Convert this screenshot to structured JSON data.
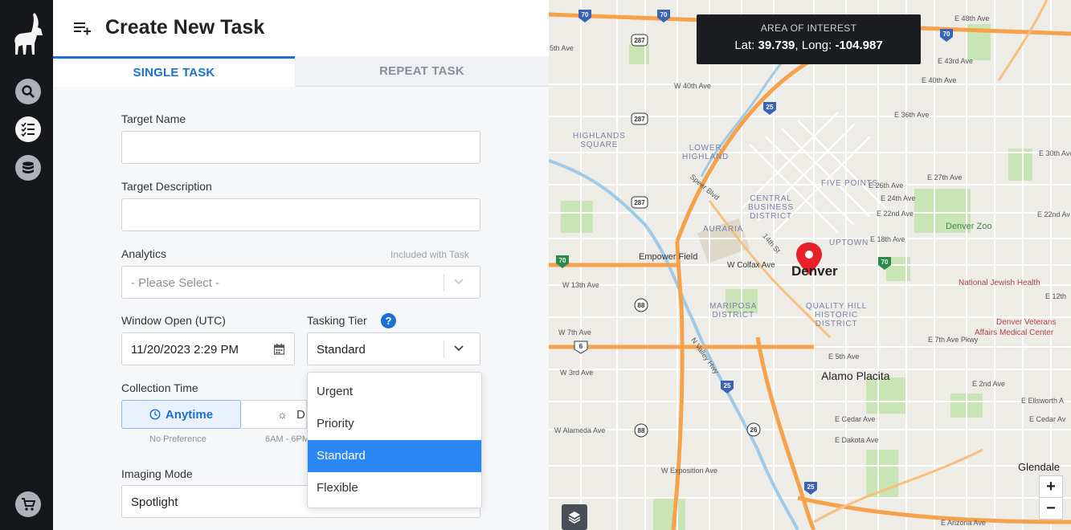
{
  "sidebar": {
    "items": [
      {
        "name": "search-icon"
      },
      {
        "name": "task-list-icon"
      },
      {
        "name": "database-icon"
      }
    ],
    "cart": "cart-icon"
  },
  "header": {
    "title": "Create New Task"
  },
  "tabs": {
    "single": "SINGLE TASK",
    "repeat": "REPEAT TASK"
  },
  "form": {
    "target_name": {
      "label": "Target Name",
      "value": ""
    },
    "target_description": {
      "label": "Target Description",
      "value": ""
    },
    "analytics": {
      "label": "Analytics",
      "hint": "Included with Task",
      "placeholder": "- Please Select -"
    },
    "window_open": {
      "label": "Window Open (UTC)",
      "value": "11/20/2023 2:29 PM"
    },
    "tasking_tier": {
      "label": "Tasking Tier",
      "value": "Standard",
      "options": [
        "Urgent",
        "Priority",
        "Standard",
        "Flexible"
      ],
      "selected": "Standard"
    },
    "collection_time": {
      "label": "Collection Time",
      "anytime": "Anytime",
      "anytime_sub": "No Preference",
      "day_partial": "D",
      "day_sub_partial": "6AM - 6PM"
    },
    "imaging_mode": {
      "label": "Imaging Mode",
      "value": "Spotlight"
    }
  },
  "map": {
    "aoi_title": "AREA OF INTEREST",
    "lat_label": "Lat:",
    "lat": "39.739",
    "long_label": "Long:",
    "long": "-104.987",
    "city": "Denver",
    "labels": {
      "alamo": "Alamo Placita",
      "glendale": "Glendale",
      "empower": "Empower Field",
      "w_colfax": "W Colfax Ave",
      "zoo": "Denver Zoo",
      "national_jewish": "National Jewish Health",
      "va": "Denver Veterans",
      "va2": "Affairs Medical Center",
      "e48": "E 48th Ave",
      "e43": "E 43rd Ave",
      "e40": "E 40th Ave",
      "e36": "E 36th Ave",
      "e30": "E 30th Ave",
      "e27": "E 27th Ave",
      "e26": "E 26th Ave",
      "e24": "E 24th Ave",
      "e22": "E 22nd Ave",
      "e22r": "E 22nd Av",
      "e18": "E 18th Ave",
      "e12": "E 12th",
      "e7": "E 7th Ave Pkwy",
      "e5": "E 5th Ave",
      "e2": "E 2nd Ave",
      "ee": "E Ellsworth A",
      "ecedar": "E Cedar Ave",
      "ecedar2": "E Cedar Av",
      "edak": "E Dakota Ave",
      "eariz": "E Arizona Ave",
      "w40": "W 40th Ave",
      "w13": "W 13th Ave",
      "w7": "W 7th Ave",
      "w3": "W 3rd Ave",
      "wal": "W Alameda Ave",
      "wexp": "W Exposition Ave",
      "fifth": "5th Ave",
      "highlands": "HIGHLANDS\nSQUARE",
      "lower_highland": "LOWER\nHIGHLAND",
      "cbd": "CENTRAL\nBUSINESS\nDISTRICT",
      "auraria": "AURARIA",
      "uptown": "UPTOWN",
      "five_points": "FIVE POINTS",
      "mariposa": "MARIPOSA\nDISTRICT",
      "quality_hill": "QUALITY HILL\nHISTORIC\nDISTRICT",
      "speer": "Speer Blvd",
      "fourteenth": "14th St",
      "vhwy": "N Valley Hwy"
    },
    "shields": [
      "70",
      "70",
      "70",
      "25",
      "25",
      "25",
      "287",
      "287",
      "287",
      "88",
      "88",
      "26",
      "6",
      "70",
      "70"
    ]
  },
  "colors": {
    "accent": "#1c6fd3",
    "selected": "#2d86f5",
    "sidebar": "#16171b",
    "highway": "#f6a14b",
    "pin": "#e8202a"
  }
}
